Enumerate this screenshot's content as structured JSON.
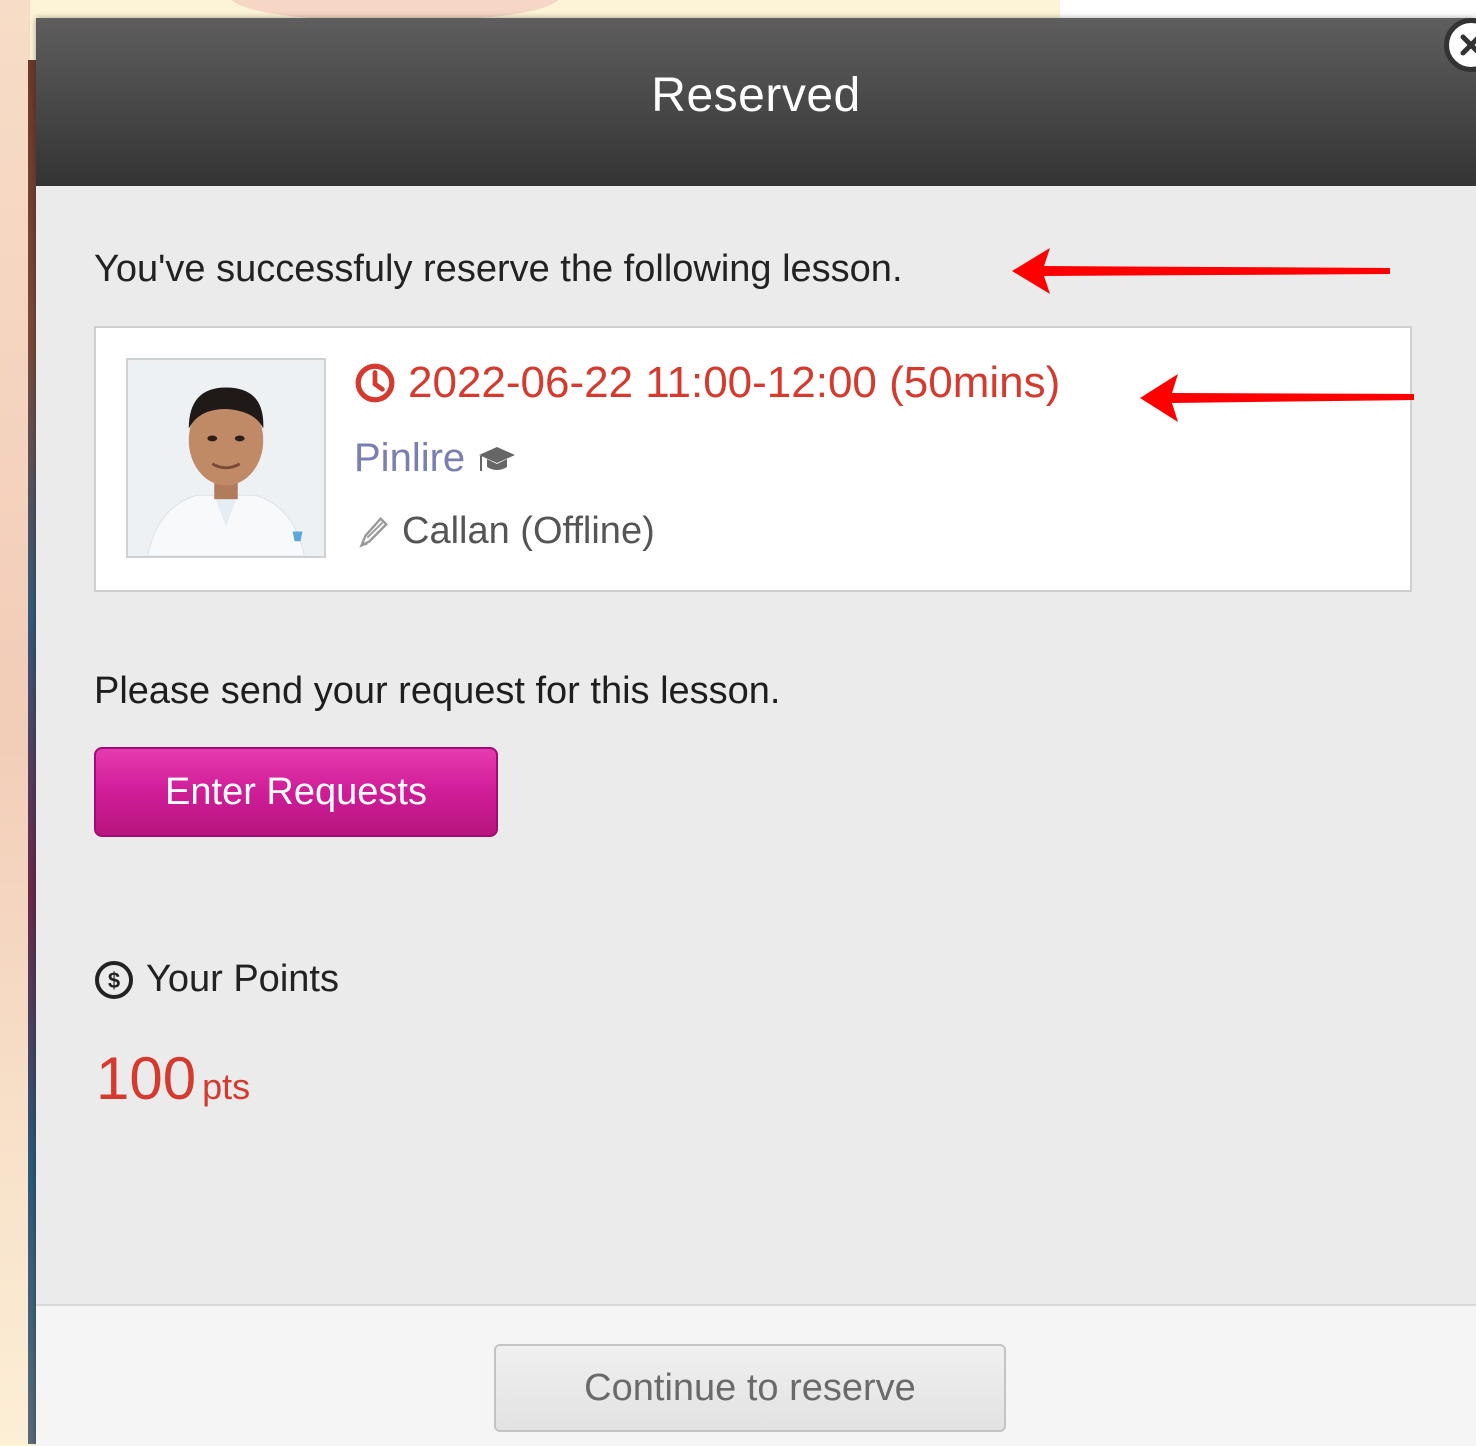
{
  "modal": {
    "title": "Reserved",
    "success_message": "You've successfuly reserve the following lesson.",
    "lesson": {
      "datetime": "2022-06-22 11:00-12:00 (50mins)",
      "teacher_name": "Pinlire",
      "course": "Callan (Offline)"
    },
    "request_prompt": "Please send your request for this lesson.",
    "enter_requests_label": "Enter Requests",
    "points": {
      "label": "Your Points",
      "value": "100",
      "unit": "pts"
    },
    "continue_label": "Continue to reserve"
  },
  "colors": {
    "accent_red": "#d63a2e",
    "button_magenta": "#cf1d98",
    "teacher_link": "#7a7fb0",
    "annotation_arrow": "#ff0000"
  },
  "icons": [
    "close-icon",
    "clock-icon",
    "graduation-cap-icon",
    "pencil-icon",
    "coin-icon",
    "teacher-photo",
    "red-arrow-annotation"
  ]
}
